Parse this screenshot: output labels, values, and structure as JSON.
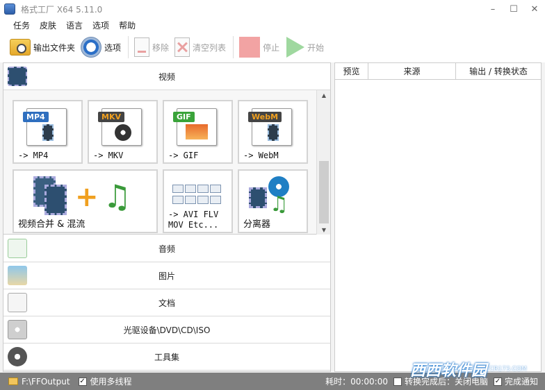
{
  "window": {
    "title": "格式工厂 X64 5.11.0",
    "minimize": "–",
    "maximize": "☐",
    "close": "✕"
  },
  "menu": [
    "任务",
    "皮肤",
    "语言",
    "选项",
    "帮助"
  ],
  "toolbar": {
    "output_folder": "输出文件夹",
    "options": "选项",
    "remove": "移除",
    "clear_list": "清空列表",
    "stop": "停止",
    "start": "开始"
  },
  "categories": {
    "video": "视频",
    "audio": "音频",
    "image": "图片",
    "document": "文档",
    "disc": "光驱设备\\DVD\\CD\\ISO",
    "tools": "工具集"
  },
  "video_tiles": [
    {
      "badge": "MP4",
      "label": "-> MP4",
      "badge_color": "#2f6fbf"
    },
    {
      "badge": "MKV",
      "label": "-> MKV",
      "badge_color": "#444444"
    },
    {
      "badge": "GIF",
      "label": "-> GIF",
      "badge_color": "#3aa33a"
    },
    {
      "badge": "WebM",
      "label": "-> WebM",
      "badge_color": "#444444"
    }
  ],
  "video_tiles_row2": {
    "merge": "视频合并 & 混流",
    "multi_line1": "-> AVI FLV",
    "multi_line2": "MOV Etc...",
    "splitter": "分离器"
  },
  "task_columns": [
    "预览",
    "来源",
    "输出 / 转换状态"
  ],
  "statusbar": {
    "output_path": "F:\\FFOutput",
    "multithread_label": "使用多线程",
    "multithread_checked": "✓",
    "elapsed": "耗时：00:00:00",
    "after_convert": "转换完成后：关闭电脑",
    "notify_label": "完成通知",
    "notify_checked": "✓"
  },
  "watermark": {
    "logo": "西西软件园",
    "sub": "CR173.COM"
  }
}
